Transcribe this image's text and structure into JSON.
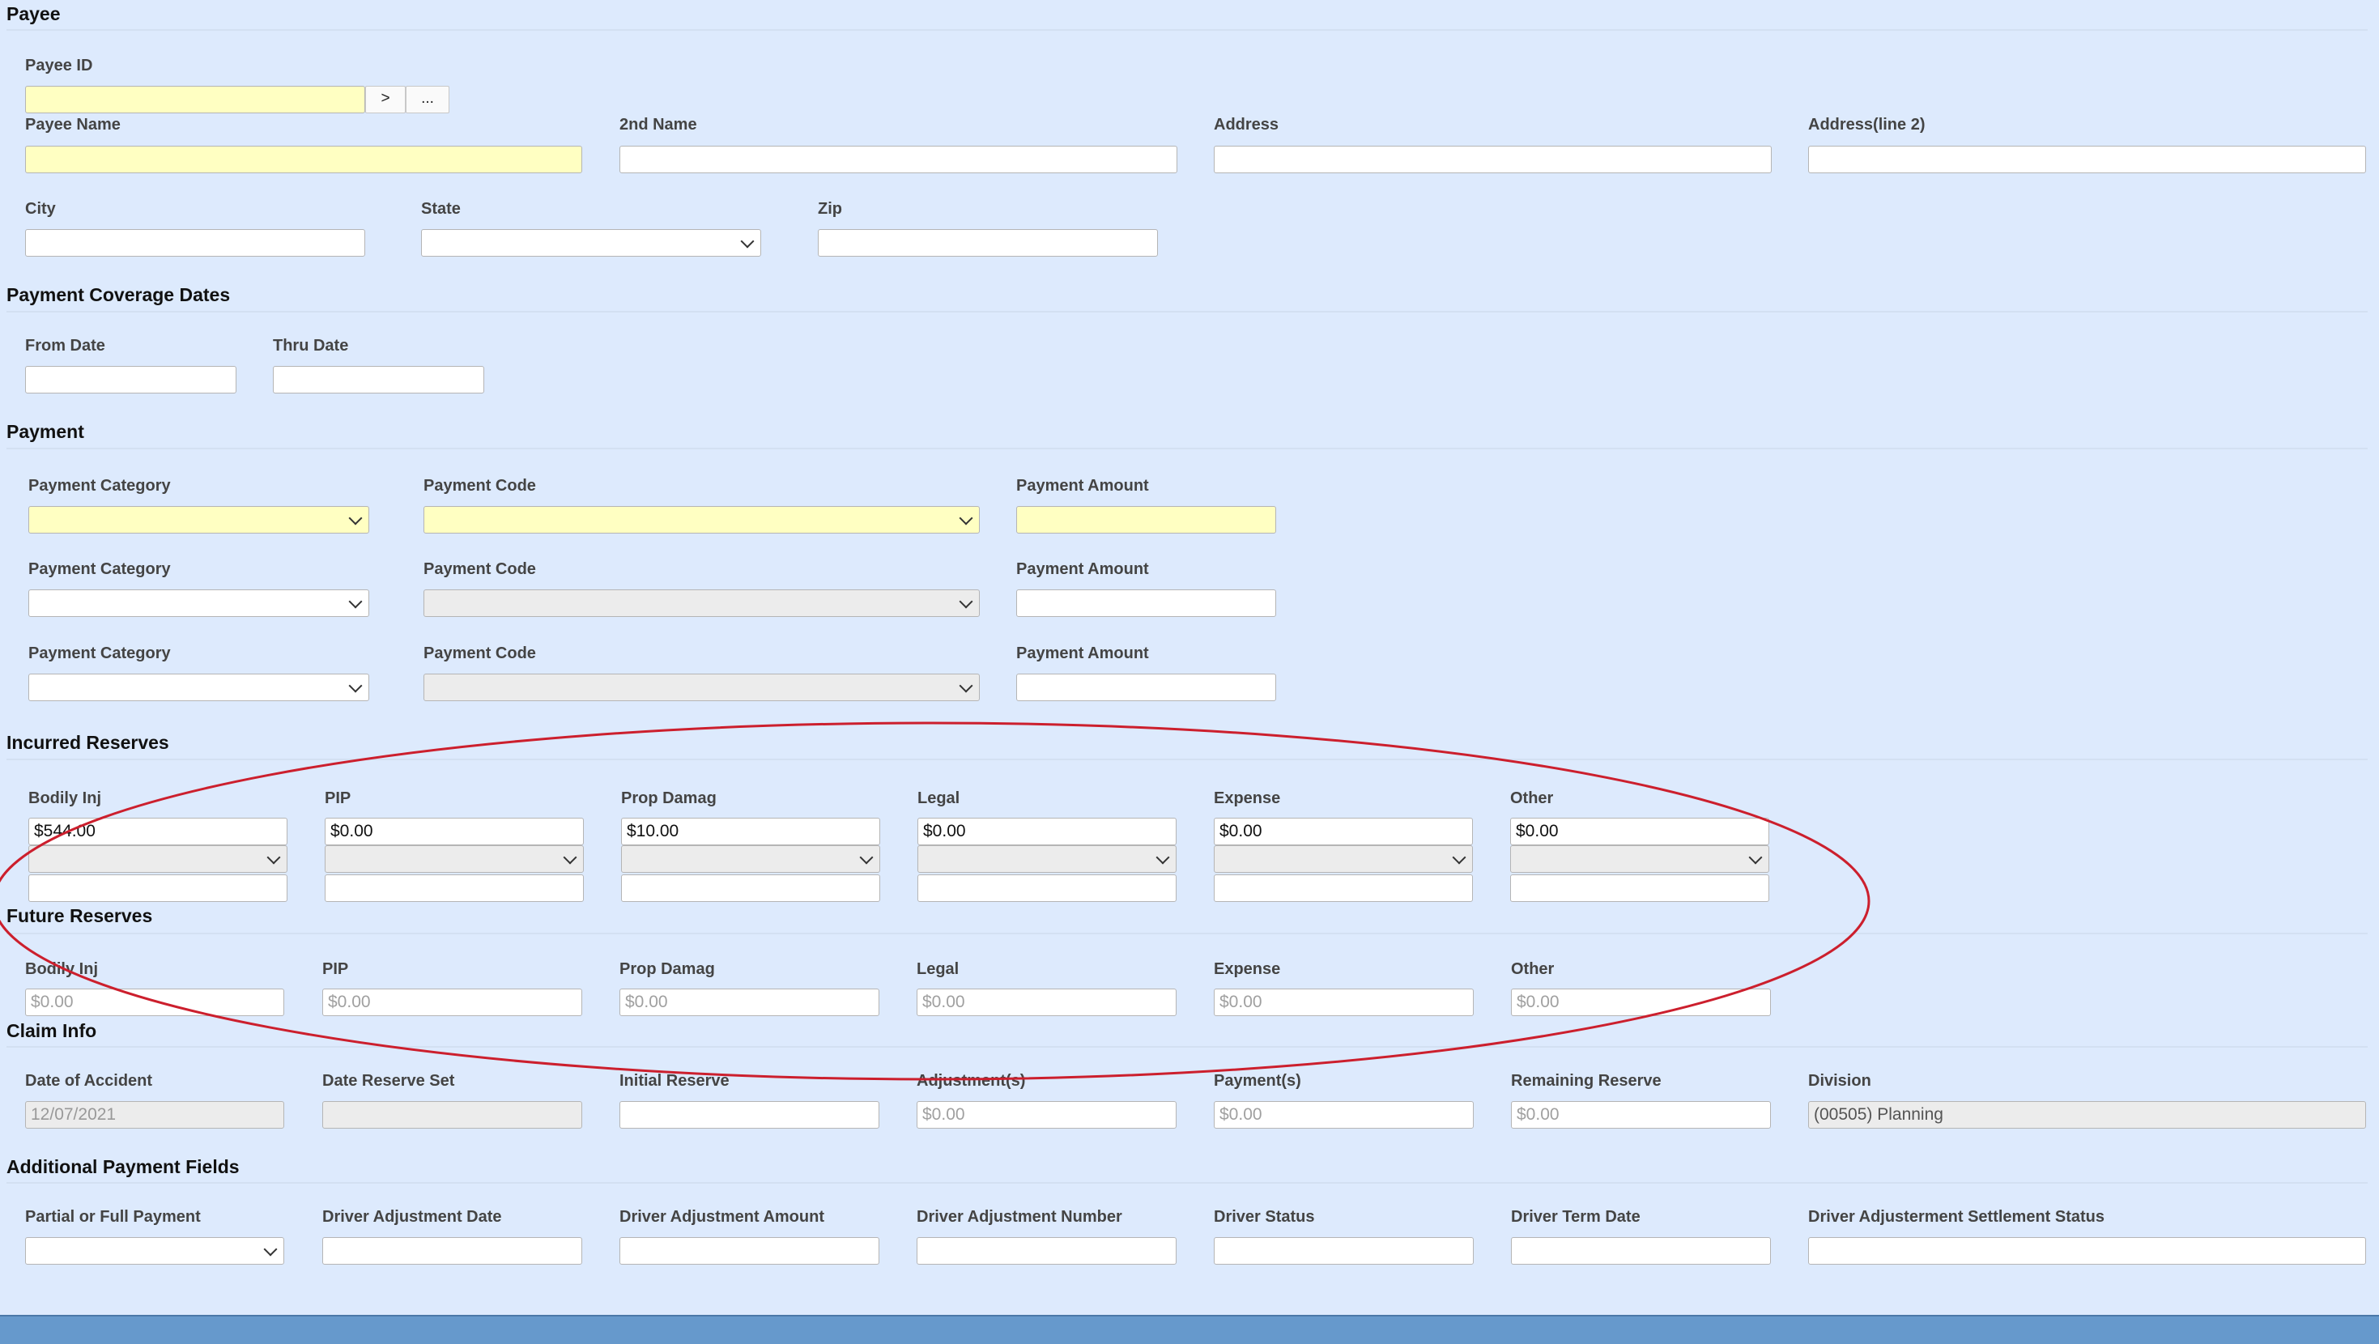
{
  "payee": {
    "title": "Payee",
    "payee_id": {
      "label": "Payee ID",
      "value": "",
      "go_label": ">",
      "lookup_label": "..."
    },
    "payee_name": {
      "label": "Payee Name",
      "value": ""
    },
    "second_name": {
      "label": "2nd Name",
      "value": ""
    },
    "address": {
      "label": "Address",
      "value": ""
    },
    "address2": {
      "label": "Address(line 2)",
      "value": ""
    },
    "city": {
      "label": "City",
      "value": ""
    },
    "state": {
      "label": "State",
      "value": ""
    },
    "zip": {
      "label": "Zip",
      "value": ""
    }
  },
  "coverage": {
    "title": "Payment Coverage Dates",
    "from_label": "From Date",
    "thru_label": "Thru Date"
  },
  "payment": {
    "title": "Payment",
    "category_label": "Payment Category",
    "code_label": "Payment Code",
    "amount_label": "Payment Amount"
  },
  "incurred": {
    "title": "Incurred Reserves",
    "columns": [
      {
        "label": "Bodily Inj",
        "value": "$544.00"
      },
      {
        "label": "PIP",
        "value": "$0.00"
      },
      {
        "label": "Prop Damag",
        "value": "$10.00"
      },
      {
        "label": "Legal",
        "value": "$0.00"
      },
      {
        "label": "Expense",
        "value": "$0.00"
      },
      {
        "label": "Other",
        "value": "$0.00"
      }
    ]
  },
  "future": {
    "title": "Future Reserves",
    "columns": [
      {
        "label": "Bodily Inj",
        "placeholder": "$0.00"
      },
      {
        "label": "PIP",
        "placeholder": "$0.00"
      },
      {
        "label": "Prop Damag",
        "placeholder": "$0.00"
      },
      {
        "label": "Legal",
        "placeholder": "$0.00"
      },
      {
        "label": "Expense",
        "placeholder": "$0.00"
      },
      {
        "label": "Other",
        "placeholder": "$0.00"
      }
    ]
  },
  "claim": {
    "title": "Claim Info",
    "date_of_accident": {
      "label": "Date of Accident",
      "value": "12/07/2021"
    },
    "date_reserve_set": {
      "label": "Date Reserve Set",
      "value": ""
    },
    "initial_reserve": {
      "label": "Initial Reserve",
      "value": ""
    },
    "adjustments": {
      "label": "Adjustment(s)",
      "placeholder": "$0.00"
    },
    "payments": {
      "label": "Payment(s)",
      "placeholder": "$0.00"
    },
    "remaining": {
      "label": "Remaining Reserve",
      "placeholder": "$0.00"
    },
    "division": {
      "label": "Division",
      "value": "(00505) Planning"
    }
  },
  "additional": {
    "title": "Additional Payment Fields",
    "partial_full": {
      "label": "Partial or Full Payment",
      "value": ""
    },
    "adj_date": {
      "label": "Driver Adjustment Date"
    },
    "adj_amount": {
      "label": "Driver Adjustment Amount"
    },
    "adj_number": {
      "label": "Driver Adjustment Number"
    },
    "driver_status": {
      "label": "Driver Status"
    },
    "driver_term": {
      "label": "Driver Term Date"
    },
    "settlement_status": {
      "label": "Driver Adjusterment Settlement Status"
    }
  },
  "colors": {
    "background": "#ddeafd",
    "required_field": "#ffffc2",
    "disabled_field": "#ececec",
    "annotation_ellipse": "#cc1f2d",
    "footer_bar": "#6699cc"
  }
}
